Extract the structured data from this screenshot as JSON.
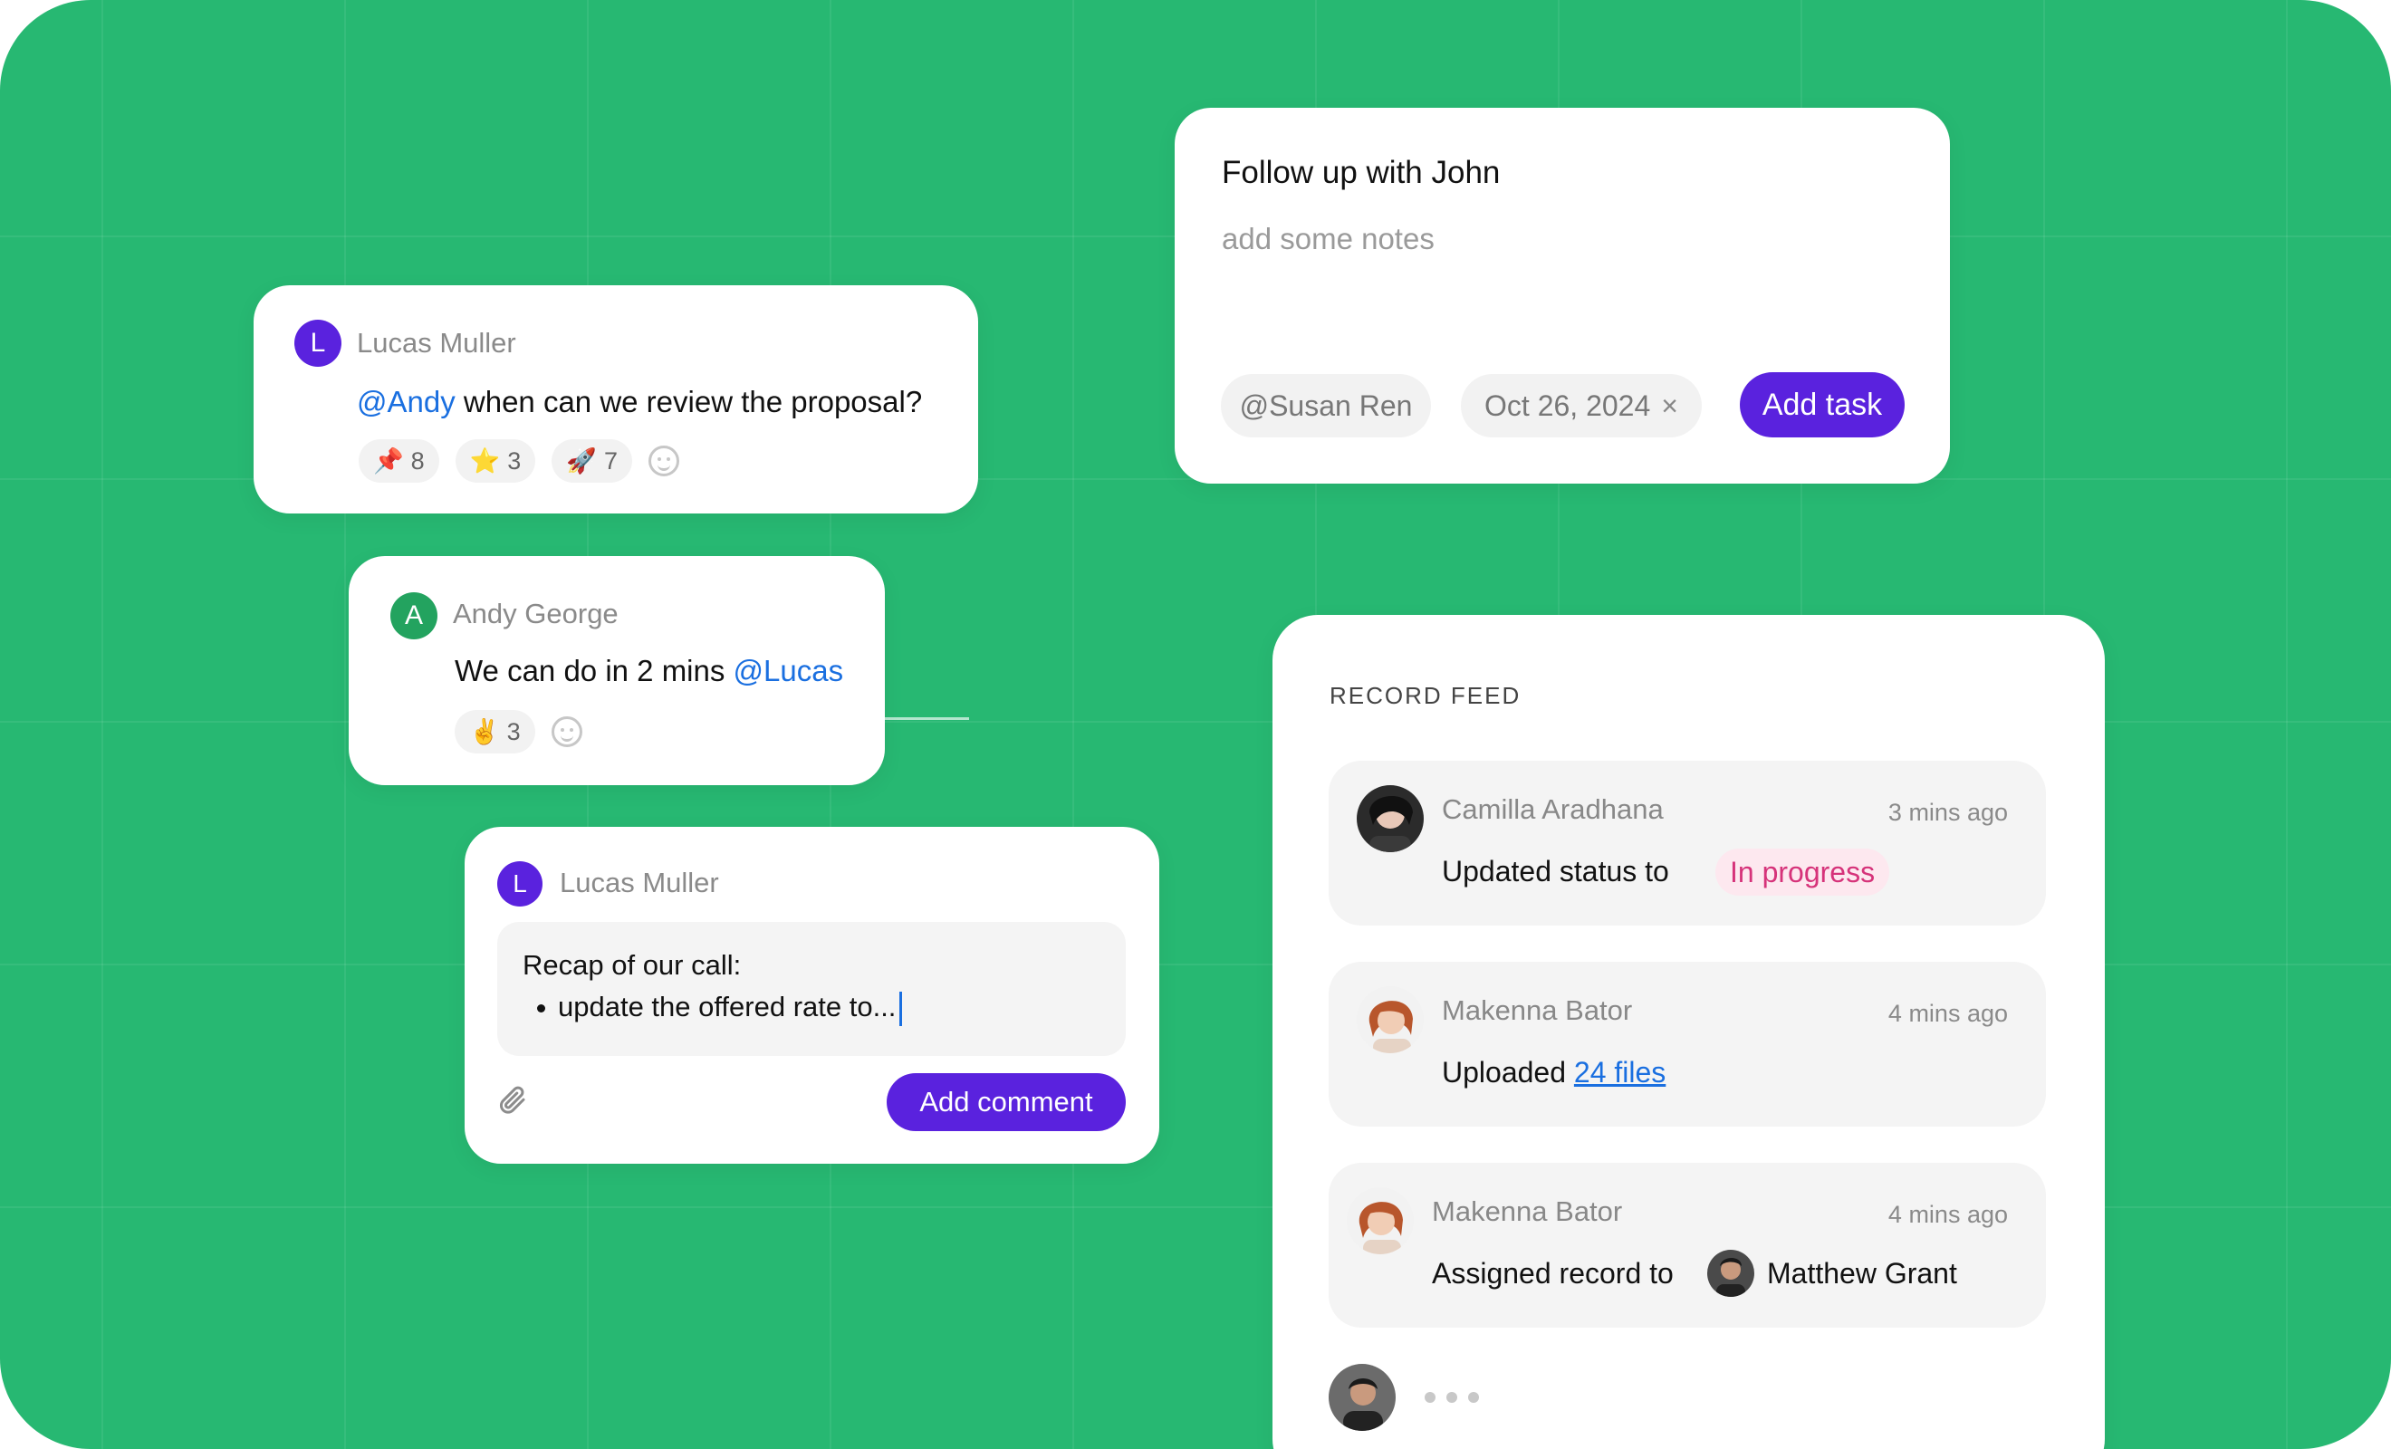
{
  "comment1": {
    "avatar_letter": "L",
    "author": "Lucas Muller",
    "mention": "@Andy",
    "text": " when can we review the proposal?",
    "reactions": [
      {
        "emoji": "📌",
        "count": "8"
      },
      {
        "emoji": "⭐",
        "count": "3"
      },
      {
        "emoji": "🚀",
        "count": "7"
      }
    ]
  },
  "comment2": {
    "avatar_letter": "A",
    "author": "Andy George",
    "text": "We can do in 2 mins ",
    "mention": "@Lucas",
    "reactions": [
      {
        "emoji": "✌️",
        "count": "3"
      }
    ]
  },
  "composer": {
    "avatar_letter": "L",
    "author": "Lucas Muller",
    "line1": "Recap of our call:",
    "bullet": "update the offered rate to...",
    "button": "Add comment"
  },
  "task": {
    "title": "Follow up with John",
    "notes_placeholder": "add some notes",
    "assignee": "@Susan Ren",
    "date": "Oct 26, 2024",
    "clear_icon": "×",
    "button": "Add task"
  },
  "feed": {
    "heading": "RECORD FEED",
    "items": [
      {
        "name": "Camilla Aradhana",
        "time": "3 mins ago",
        "text": "Updated status to",
        "badge": "In progress"
      },
      {
        "name": "Makenna Bator",
        "time": "4 mins ago",
        "text": "Uploaded ",
        "link": "24 files"
      },
      {
        "name": "Makenna Bator",
        "time": "4 mins ago",
        "text": "Assigned record to",
        "assignee": "Matthew Grant"
      }
    ]
  },
  "colors": {
    "background": "#27b872",
    "accent": "#5a22de",
    "mention": "#1a6fe0",
    "badge_text": "#d6337a",
    "badge_bg": "#fde8ef"
  }
}
